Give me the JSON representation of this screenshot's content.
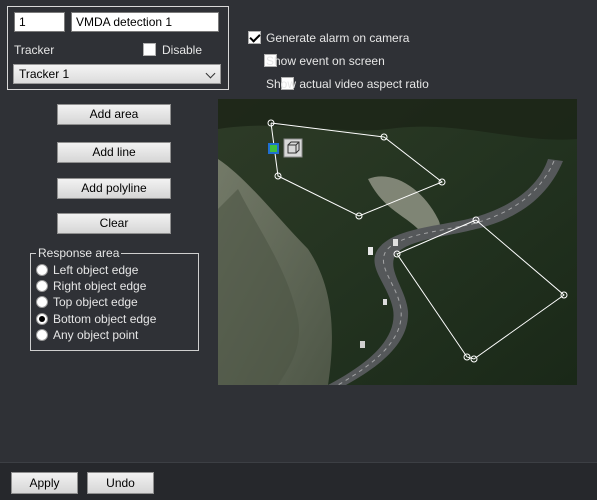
{
  "detector": {
    "id_value": "1",
    "name_value": "VMDA detection 1"
  },
  "tracker": {
    "label": "Tracker",
    "disable_label": "Disable",
    "disable_checked": false,
    "selected": "Tracker 1"
  },
  "options": {
    "generate_alarm": {
      "label": "Generate alarm on camera",
      "checked": true
    },
    "show_event": {
      "label": "Show event on screen",
      "checked": false
    },
    "aspect_ratio": {
      "label": "Show actual video aspect ratio",
      "checked": false
    }
  },
  "buttons": {
    "add_area": "Add area",
    "add_line": "Add line",
    "add_polyline": "Add polyline",
    "clear": "Clear"
  },
  "response_area": {
    "legend": "Response area",
    "options": [
      {
        "label": "Left object edge",
        "selected": false
      },
      {
        "label": "Right object edge",
        "selected": false
      },
      {
        "label": "Top object edge",
        "selected": false
      },
      {
        "label": "Bottom object edge",
        "selected": true
      },
      {
        "label": "Any object point",
        "selected": false
      }
    ]
  },
  "footer": {
    "apply": "Apply",
    "undo": "Undo"
  },
  "colors": {
    "background": "#2f3136",
    "zone_stroke": "#ffffff",
    "handle_selected": "#1f6fd1",
    "handle_selected_inner": "#3fbf3f"
  }
}
